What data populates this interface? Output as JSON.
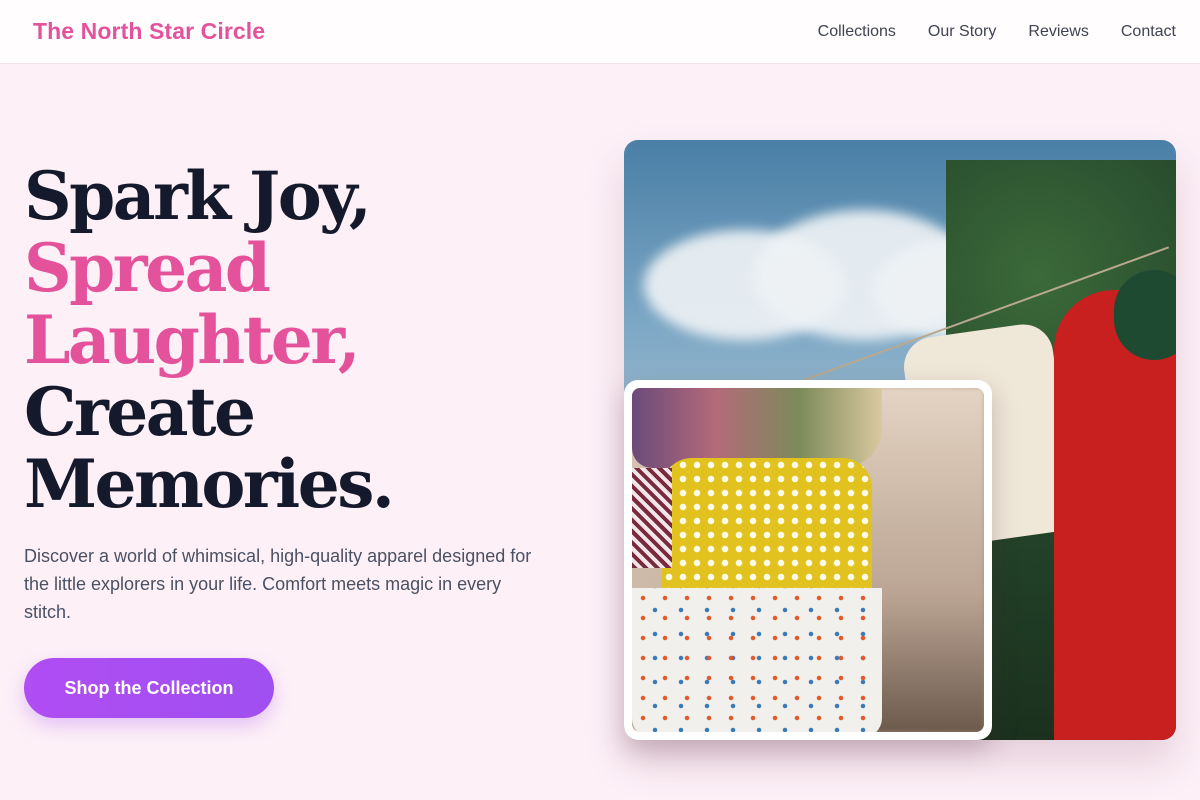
{
  "nav": {
    "brand": "The North Star Circle",
    "links": [
      "Collections",
      "Our Story",
      "Reviews",
      "Contact"
    ]
  },
  "hero": {
    "headline": {
      "line1": "Spark Joy,",
      "line2": "Spread",
      "line3": "Laughter,",
      "line4": "Create",
      "line5": "Memories."
    },
    "subtitle": "Discover a world of whimsical, high-quality apparel designed for the little explorers in your life. Comfort meets magic in every stitch.",
    "cta": "Shop the Collection"
  },
  "colors": {
    "accent_pink": "#e4529b",
    "heading_dark": "#141a2b",
    "cta_purple": "#a94ef2",
    "page_bg": "#fdf0f7"
  }
}
